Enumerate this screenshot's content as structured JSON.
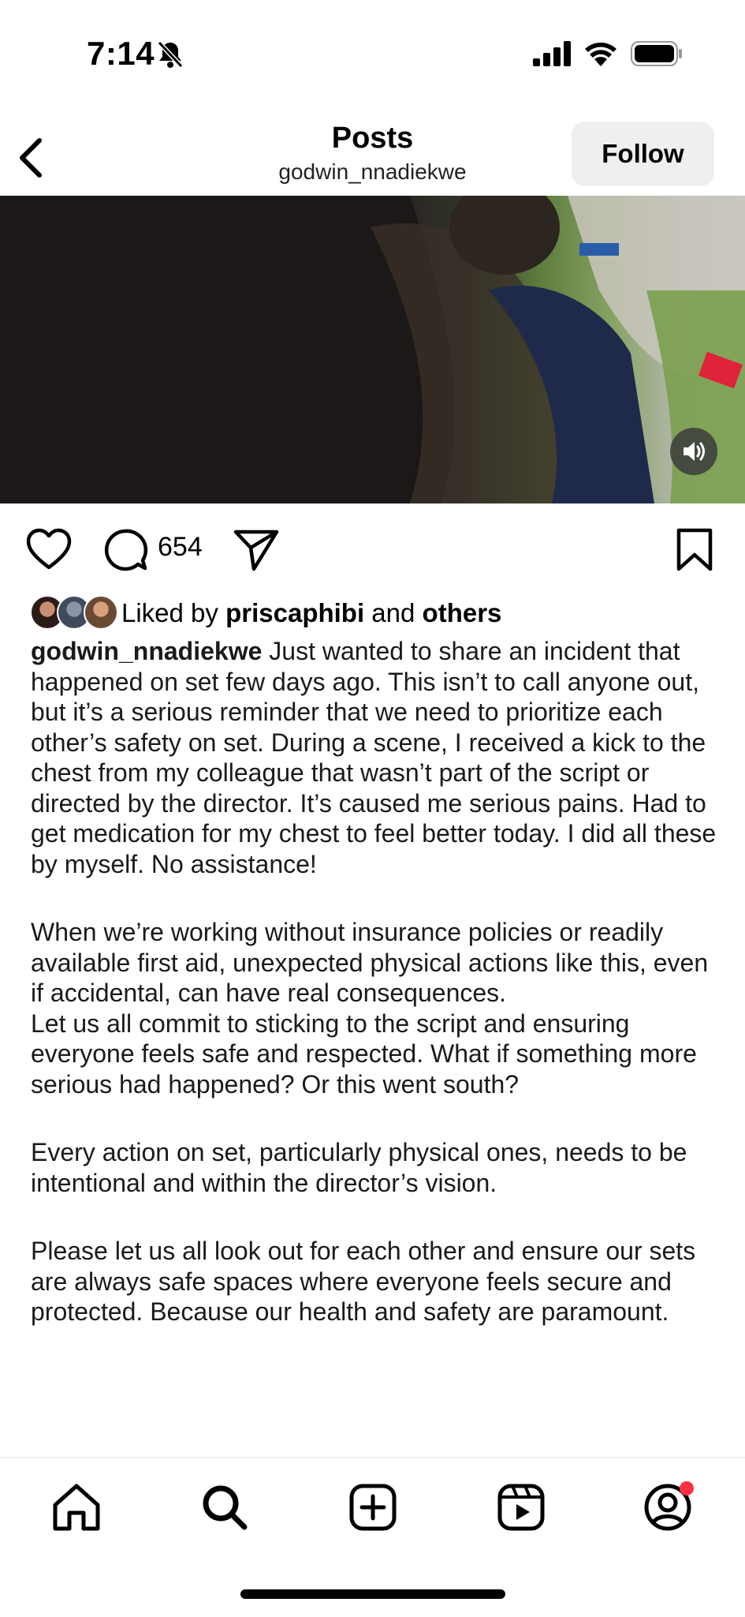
{
  "status_bar": {
    "time": "7:14",
    "icons": [
      "bell-slash-icon",
      "cellular-signal-icon",
      "wifi-icon",
      "battery-icon"
    ]
  },
  "header": {
    "title": "Posts",
    "username": "godwin_nnadiekwe",
    "follow_label": "Follow"
  },
  "media": {
    "type": "video",
    "audio_icon": "speaker-icon"
  },
  "actions": {
    "comment_count": "654"
  },
  "likes": {
    "prefix": "Liked by ",
    "user": "priscaphibi",
    "middle": " and ",
    "others": "others"
  },
  "caption": {
    "author": "godwin_nnadiekwe",
    "paragraphs": [
      "Just wanted to share an incident that happened on set few days ago. This isn’t to call anyone out, but it’s a serious reminder that we need to prioritize each other’s safety on set. During a scene, I received a kick to the chest from my colleague that wasn’t part of the script or directed by the director. It’s caused me serious pains. Had to get medication for my chest to feel better today. I did all these by myself. No assistance!",
      "When we’re working without insurance policies or readily available first aid, unexpected physical actions like this, even if accidental, can have real consequences.",
      "Let us all commit to sticking to the script and ensuring everyone feels safe and respected. What if something more serious had happened? Or this went south?",
      "Every action on set, particularly physical ones, needs to be intentional and within the director’s vision.",
      "Please let us all look out for each other and ensure our sets are always safe spaces where everyone feels secure and protected. Because our health and safety are paramount."
    ]
  },
  "tabbar": {
    "tabs": [
      "home",
      "search",
      "create",
      "reels",
      "profile"
    ],
    "notification_dot_color": "#ff3040"
  }
}
